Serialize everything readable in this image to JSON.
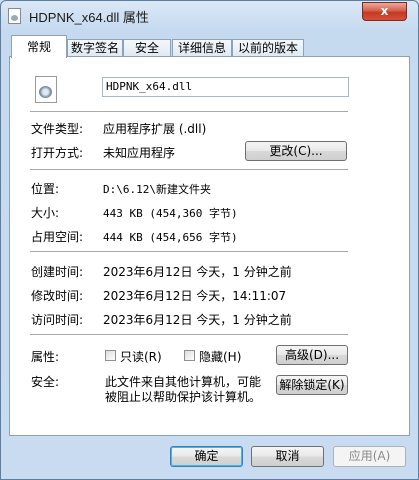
{
  "window": {
    "title": "HDPNK_x64.dll 属性",
    "close_label": "x"
  },
  "tabs": [
    "常规",
    "数字签名",
    "安全",
    "详细信息",
    "以前的版本"
  ],
  "general": {
    "filename": "HDPNK_x64.dll",
    "rows": {
      "file_type": {
        "label": "文件类型:",
        "value": "应用程序扩展 (.dll)"
      },
      "opens_with": {
        "label": "打开方式:",
        "value": "未知应用程序",
        "button": "更改(C)..."
      },
      "location": {
        "label": "位置:",
        "value": "D:\\6.12\\新建文件夹"
      },
      "size": {
        "label": "大小:",
        "value": "443 KB (454,360 字节)"
      },
      "size_on_disk": {
        "label": "占用空间:",
        "value": "444 KB (454,656 字节)"
      },
      "created": {
        "label": "创建时间:",
        "value": "2023年6月12日 今天，1 分钟之前"
      },
      "modified": {
        "label": "修改时间:",
        "value": "2023年6月12日 今天，14:11:07"
      },
      "accessed": {
        "label": "访问时间:",
        "value": "2023年6月12日 今天，1 分钟之前"
      }
    },
    "attributes": {
      "label": "属性:",
      "readonly": "只读(R)",
      "hidden": "隐藏(H)",
      "advanced_button": "高级(D)..."
    },
    "security": {
      "label": "安全:",
      "text_line1": "此文件来自其他计算机，可能",
      "text_line2": "被阻止以帮助保护该计算机。",
      "unblock_button": "解除锁定(K)"
    }
  },
  "footer": {
    "ok": "确定",
    "cancel": "取消",
    "apply": "应用(A)"
  }
}
